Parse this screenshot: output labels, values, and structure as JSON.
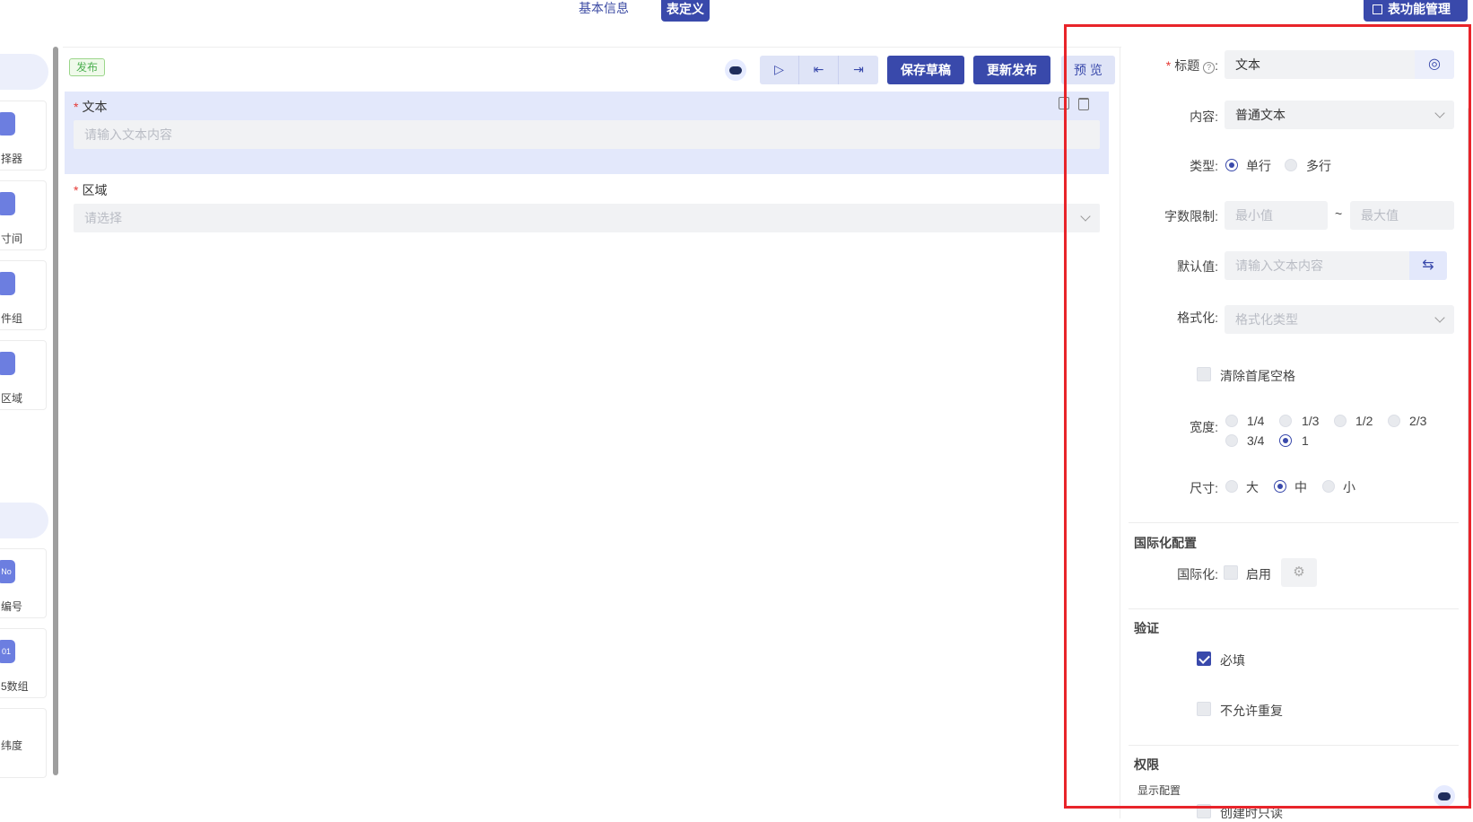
{
  "top_nav": {
    "tab_basic": "基本信息",
    "tab_form": "表定义",
    "manage_button": "表功能管理"
  },
  "palette": {
    "items": [
      {
        "label": "择器",
        "icon": "mail-icon"
      },
      {
        "label": "寸间",
        "icon": "clock-icon"
      },
      {
        "label": "件组",
        "icon": "chart-icon"
      },
      {
        "label": "区域",
        "icon": "map-icon"
      },
      {
        "label": "编号",
        "icon": "number-icon"
      },
      {
        "label": "5数组",
        "icon": "array-icon"
      },
      {
        "label": "纬度",
        "icon": "globe-icon"
      }
    ],
    "icon_texts": [
      "",
      "",
      "",
      "",
      "No",
      "01",
      ""
    ]
  },
  "canvas": {
    "status_tag": "发布",
    "save_draft": "保存草稿",
    "update_publish": "更新发布",
    "preview": "预 览",
    "field1": {
      "label": "文本",
      "placeholder": "请输入文本内容"
    },
    "field2": {
      "label": "区域",
      "placeholder": "请选择"
    }
  },
  "panel": {
    "title_label": "标题",
    "title_value": "文本",
    "content_label": "内容:",
    "content_value": "普通文本",
    "type_label": "类型:",
    "type_options": [
      "单行",
      "多行"
    ],
    "type_selected": "单行",
    "limit_label": "字数限制:",
    "limit_min_placeholder": "最小值",
    "limit_sep": "~",
    "limit_max_placeholder": "最大值",
    "default_label": "默认值:",
    "default_placeholder": "请输入文本内容",
    "format_label": "格式化:",
    "format_placeholder": "格式化类型",
    "trim_label": "清除首尾空格",
    "width_label": "宽度:",
    "width_options": [
      "1/4",
      "1/3",
      "1/2",
      "2/3",
      "3/4",
      "1"
    ],
    "width_selected": "1",
    "size_label": "尺寸:",
    "size_options": [
      "大",
      "中",
      "小"
    ],
    "size_selected": "中",
    "i18n_section": "国际化配置",
    "i18n_label": "国际化:",
    "i18n_enable": "启用",
    "validate_section": "验证",
    "required_label": "必填",
    "no_dup_label": "不允许重复",
    "perm_section": "权限",
    "display_config": "显示配置",
    "readonly_on_create": "创建时只读"
  },
  "colors": {
    "accent": "#3949ab",
    "annotation_box": "#e8242a"
  }
}
